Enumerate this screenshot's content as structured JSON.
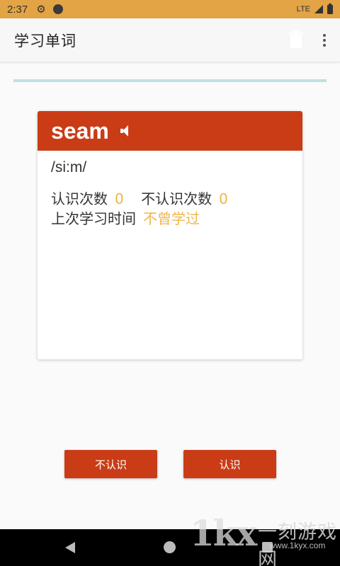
{
  "status_bar": {
    "time": "2:37",
    "network": "LTE"
  },
  "app_bar": {
    "title": "学习单词",
    "actions": [
      "trash-icon",
      "more-vert-icon"
    ]
  },
  "card": {
    "word": "seam",
    "phonetic": "/si:m/",
    "known_label": "认识次数",
    "known_count": "0",
    "unknown_label": "不认识次数",
    "unknown_count": "0",
    "last_study_label": "上次学习时间",
    "last_study_value": "不曾学过"
  },
  "buttons": {
    "unknown": "不认识",
    "known": "认识"
  },
  "watermark": {
    "logo": "1kx",
    "name": "一刻游戏网",
    "url": "www.1kyx.com"
  },
  "colors": {
    "status_bar": "#e3a445",
    "accent": "#c93c16",
    "count_highlight": "#f0b648",
    "progress_track": "#bfe2e0"
  }
}
